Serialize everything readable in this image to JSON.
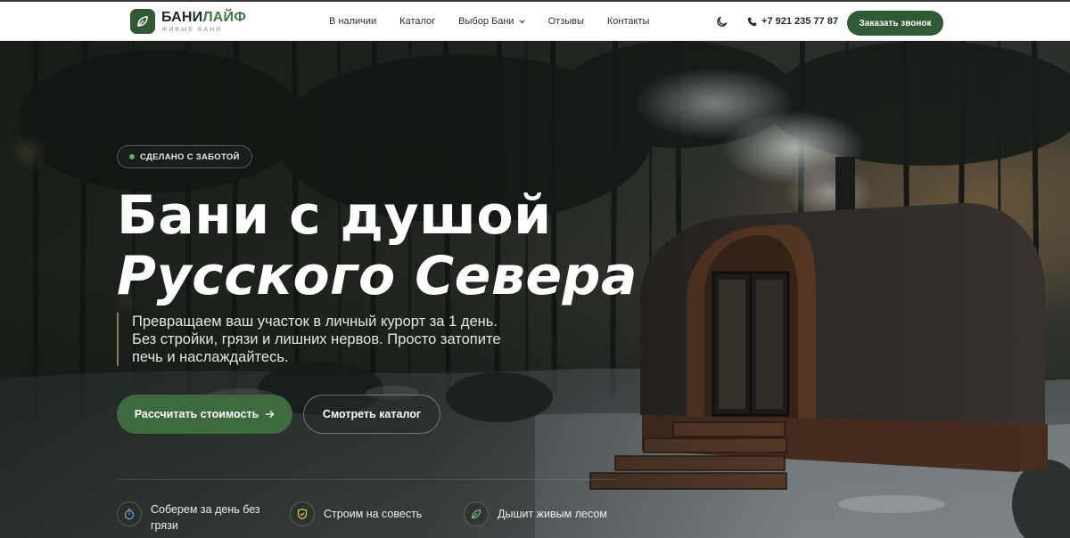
{
  "brand": {
    "name_part1": "БАНИ",
    "name_part2": "ЛАЙФ",
    "tagline": "ЖИВЫЕ БАНИ",
    "accent_color": "#2f5a33"
  },
  "nav": {
    "items": [
      {
        "label": "В наличии"
      },
      {
        "label": "Каталог"
      },
      {
        "label": "Выбор Бани",
        "has_dropdown": true
      },
      {
        "label": "Отзывы"
      },
      {
        "label": "Контакты"
      }
    ]
  },
  "header": {
    "theme_icon": "moon-icon",
    "phone_icon": "phone-icon",
    "phone": "+7 921 235 77 87",
    "cta": "Заказать звонок"
  },
  "hero": {
    "badge": "СДЕЛАНО С ЗАБОТОЙ",
    "title_line1": "Бани с душой",
    "title_line2": "Русского Севера",
    "lead": "Превращаем ваш участок в личный курорт за 1 день. Без стройки, грязи и лишних нервов. Просто затопите печь и наслаждайтесь.",
    "primary_button": "Рассчитать стоимость",
    "secondary_button": "Смотреть каталог"
  },
  "features": [
    {
      "icon": "stopwatch-icon",
      "text": "Соберем за день без грязи"
    },
    {
      "icon": "shield-check-icon",
      "text": "Строим на совесть"
    },
    {
      "icon": "leaf-icon",
      "text": "Дышит живым лесом"
    }
  ]
}
